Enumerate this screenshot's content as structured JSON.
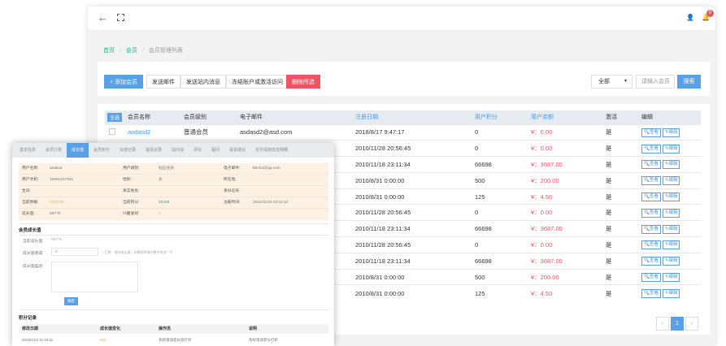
{
  "topbar": {
    "back_icon": "←",
    "user_icon": "👤",
    "bell_icon": "🔔",
    "badge": "0"
  },
  "breadcrumb": [
    "首页",
    "会员",
    "会员管理列表"
  ],
  "toolbar": {
    "add": "+ 添加会员",
    "mail": "发送邮件",
    "msg": "发送站内消息",
    "freeze": "冻结账户或激活访问",
    "delete": "删除所选",
    "filter_value": "全部",
    "search_placeholder": "请输入会员",
    "search_btn": "搜索"
  },
  "table": {
    "all_btn": "全选",
    "headers": [
      "会员名称",
      "会员级别",
      "电子邮件",
      "注册日期",
      "用户积分",
      "用户余额",
      "激活",
      "编辑"
    ],
    "rows": [
      {
        "name": "asdasd2",
        "level": "普通会员",
        "email": "asdasd2@asd.com",
        "date": "2018/8/17 9:47:17",
        "points": "0",
        "balance": "¥：0.00",
        "active": "是"
      },
      {
        "name": "",
        "level": "",
        "email": "",
        "date": "2010/11/28 20:56:45",
        "points": "0",
        "balance": "¥：0.00",
        "active": "是"
      },
      {
        "name": "",
        "level": "",
        "email": "",
        "date": "2010/11/18 23:11:34",
        "points": "66698",
        "balance": "¥：3687.00",
        "active": "是"
      },
      {
        "name": "",
        "level": "",
        "email": "",
        "date": "2010/8/31 0:00:00",
        "points": "500",
        "balance": "¥：200.00",
        "active": "是"
      },
      {
        "name": "",
        "level": "",
        "email": "",
        "date": "2010/8/31 0:00:00",
        "points": "125",
        "balance": "¥：4.50",
        "active": "是"
      },
      {
        "name": "",
        "level": "",
        "email": "",
        "date": "2010/11/28 20:56:45",
        "points": "0",
        "balance": "¥：0.00",
        "active": "是"
      },
      {
        "name": "",
        "level": "",
        "email": "",
        "date": "2010/11/18 23:11:34",
        "points": "66698",
        "balance": "¥：3687.00",
        "active": "是"
      },
      {
        "name": "",
        "level": "",
        "email": "",
        "date": "2010/11/28 20:56:45",
        "points": "0",
        "balance": "¥：0.00",
        "active": "是"
      },
      {
        "name": "",
        "level": "",
        "email": "",
        "date": "2010/11/18 23:11:34",
        "points": "66698",
        "balance": "¥：3687.00",
        "active": "是"
      },
      {
        "name": "",
        "level": "",
        "email": "",
        "date": "2010/8/31 0:00:00",
        "points": "500",
        "balance": "¥：200.00",
        "active": "是"
      },
      {
        "name": "",
        "level": "",
        "email": "",
        "date": "2010/8/31 0:00:00",
        "points": "125",
        "balance": "¥：4.50",
        "active": "是"
      }
    ],
    "view_btn": "🔍查看",
    "edit_btn": "✎编辑"
  },
  "pager": {
    "prev": "‹",
    "page": "1",
    "next": "›"
  },
  "panel": {
    "tabs": [
      "基本信息",
      "会员订单",
      "成长值",
      "会员积分",
      "充值记录",
      "提现记录",
      "站内信",
      "评论",
      "提问",
      "投诉建议",
      "支付请款收支明细"
    ],
    "info": {
      "username_l": "用户名称:",
      "username_v": "asdasd",
      "level_l": "用户级别:",
      "level_v": "钻石会员",
      "email_l": "电子邮件:",
      "email_v": "bbch2@qq.com",
      "phone_l": "用户手机:",
      "phone_v": "15982227931",
      "gender_l": "性别:",
      "gender_v": "女",
      "location_l": "所在地:",
      "birthday_l": "生日:",
      "realname_l": "真实姓名:",
      "idcard_l": "身份证号:",
      "balance_l": "当前余额:",
      "balance_v": "3124.00",
      "points_l": "当前积分:",
      "points_v": "53468",
      "regtime_l": "注册时间:",
      "regtime_v": "2010/11/18 23:11:34",
      "growth_l": "成长值:",
      "growth_v": "69770",
      "gift_l": "兴趣爱好:",
      "gift_v": "1"
    },
    "growth_title": "会员成长值",
    "cur_growth_l": "当前成长值:",
    "cur_growth_v": "69770",
    "adjust_l": "成长值增减:",
    "adjust_v": "0",
    "adjust_note": "* 正数：增加成长值；如需扣除请在数字前加“-”号",
    "desc_l": "成长值描述:",
    "save": "确定",
    "points_title": "积分记录",
    "log_headers": [
      "修改日期",
      "成长值变化",
      "操作员",
      "说明"
    ],
    "log_row": {
      "date": "2018/1/23 11:18:11",
      "change": "500",
      "operator": "系统增减成长值打折",
      "note": "系统增减积分打折"
    }
  }
}
